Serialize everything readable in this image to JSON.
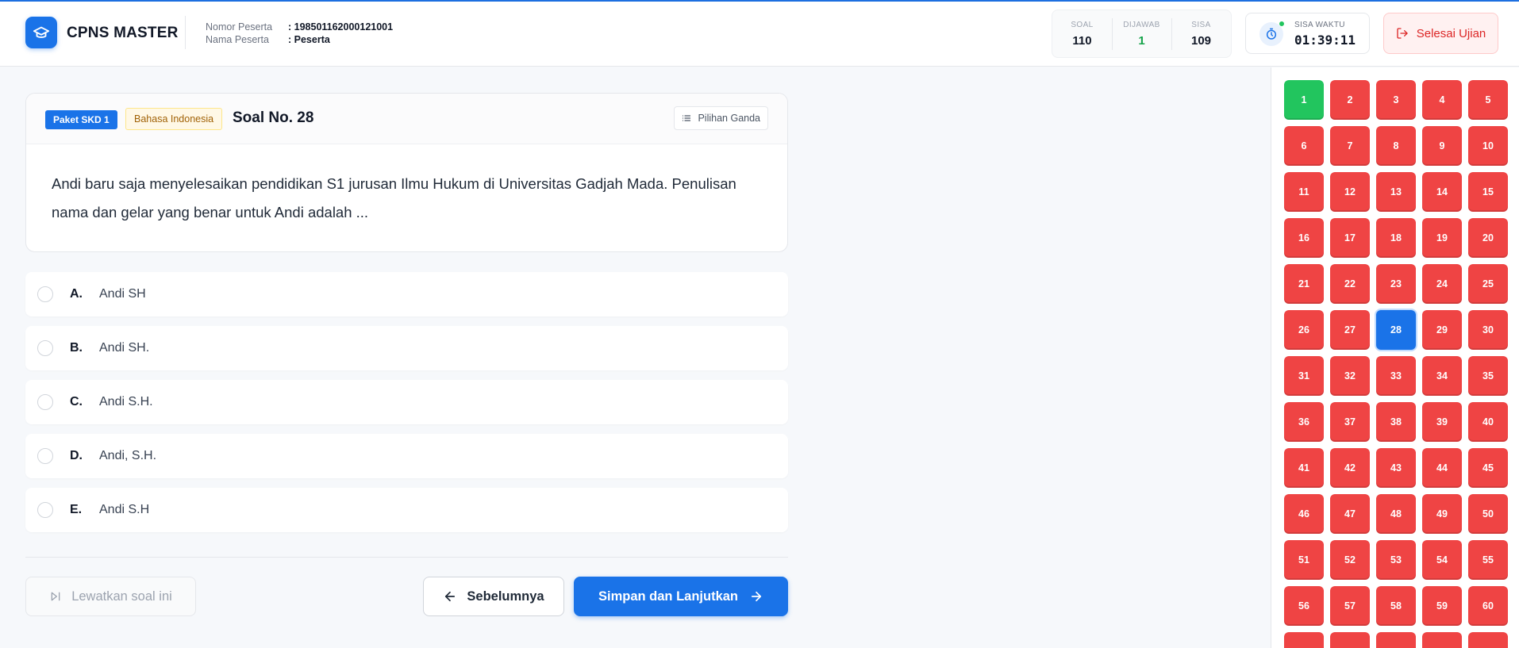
{
  "brand": {
    "name": "CPNS MASTER"
  },
  "participant": {
    "number_label": "Nomor Peserta",
    "number_value": ": 198501162000121001",
    "name_label": "Nama Peserta",
    "name_value": ": Peserta"
  },
  "stats": {
    "soal_label": "SOAL",
    "soal_value": "110",
    "dijawab_label": "DIJAWAB",
    "dijawab_value": "1",
    "sisa_label": "SISA",
    "sisa_value": "109"
  },
  "timer": {
    "label": "SISA WAKTU",
    "value": "01:39:11"
  },
  "finish_button": "Selesai Ujian",
  "question": {
    "package_badge": "Paket SKD 1",
    "subject_badge": "Bahasa Indonesia",
    "title": "Soal No. 28",
    "type": "Pilihan Ganda",
    "text": "Andi baru saja menyelesaikan pendidikan S1 jurusan Ilmu Hukum di Universitas Gadjah Mada. Penulisan nama dan gelar yang benar untuk Andi adalah ..."
  },
  "options": [
    {
      "letter": "A.",
      "text": "Andi SH"
    },
    {
      "letter": "B.",
      "text": "Andi SH."
    },
    {
      "letter": "C.",
      "text": "Andi S.H."
    },
    {
      "letter": "D.",
      "text": "Andi, S.H."
    },
    {
      "letter": "E.",
      "text": "Andi S.H"
    }
  ],
  "nav": {
    "skip": "Lewatkan soal ini",
    "prev": "Sebelumnya",
    "next": "Simpan dan Lanjutkan"
  },
  "question_grid": {
    "total": 65,
    "answered": [
      1
    ],
    "current": 28
  },
  "colors": {
    "primary": "#1a73e8",
    "answered": "#22c55e",
    "unanswered": "#ef4444",
    "danger": "#dc2626"
  }
}
